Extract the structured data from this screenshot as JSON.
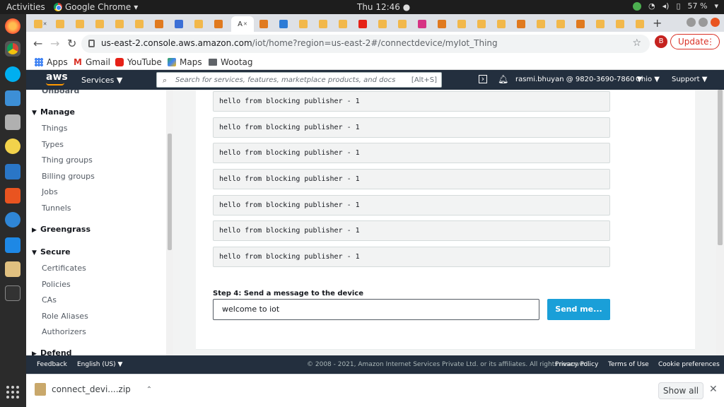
{
  "os": {
    "activities": "Activities",
    "app_name": "Google Chrome",
    "clock": "Thu 12:46 ●",
    "battery": "57 %"
  },
  "browser": {
    "url_host": "us-east-2.console.aws.amazon.com",
    "url_path": "/iot/home?region=us-east-2#/connectdevice/myIot_Thing",
    "profile_initial": "B",
    "update_label": "Update",
    "bookmarks": [
      {
        "label": "Apps",
        "icon": "apps-grid-icon"
      },
      {
        "label": "Gmail",
        "icon": "gmail-icon"
      },
      {
        "label": "YouTube",
        "icon": "youtube-icon"
      },
      {
        "label": "Maps",
        "icon": "maps-icon"
      },
      {
        "label": "Wootag",
        "icon": "folder-icon"
      }
    ]
  },
  "aws": {
    "logo": "aws",
    "services": "Services ▼",
    "search_placeholder": "Search for services, features, marketplace products, and docs",
    "search_shortcut": "[Alt+S]",
    "account": "rasmi.bhuyan @ 9820-3690-7860 ▼",
    "region": "Ohio ▼",
    "support": "Support ▼"
  },
  "sidebar": {
    "partial_top": "Onboard",
    "manage_header": "Manage",
    "manage_items": [
      "Things",
      "Types",
      "Thing groups",
      "Billing groups",
      "Jobs",
      "Tunnels"
    ],
    "greengrass_header": "Greengrass",
    "secure_header": "Secure",
    "secure_items": [
      "Certificates",
      "Policies",
      "CAs",
      "Role Aliases",
      "Authorizers"
    ],
    "defend_header": "Defend"
  },
  "main": {
    "messages": [
      "hello from blocking publisher - 1",
      "hello from blocking publisher - 1",
      "hello from blocking publisher - 1",
      "hello from blocking publisher - 1",
      "hello from blocking publisher - 1",
      "hello from blocking publisher - 1",
      "hello from blocking publisher - 1"
    ],
    "step_label": "Step 4: Send a message to the device",
    "input_value": "welcome to iot",
    "send_button": "Send me..."
  },
  "footer": {
    "feedback": "Feedback",
    "language": "English (US) ▼",
    "copyright": "© 2008 - 2021, Amazon Internet Services Private Ltd. or its affiliates. All rights reserved.",
    "privacy": "Privacy Policy",
    "terms": "Terms of Use",
    "cookies": "Cookie preferences"
  },
  "downloads": {
    "file": "connect_devi....zip",
    "show_all": "Show all"
  }
}
